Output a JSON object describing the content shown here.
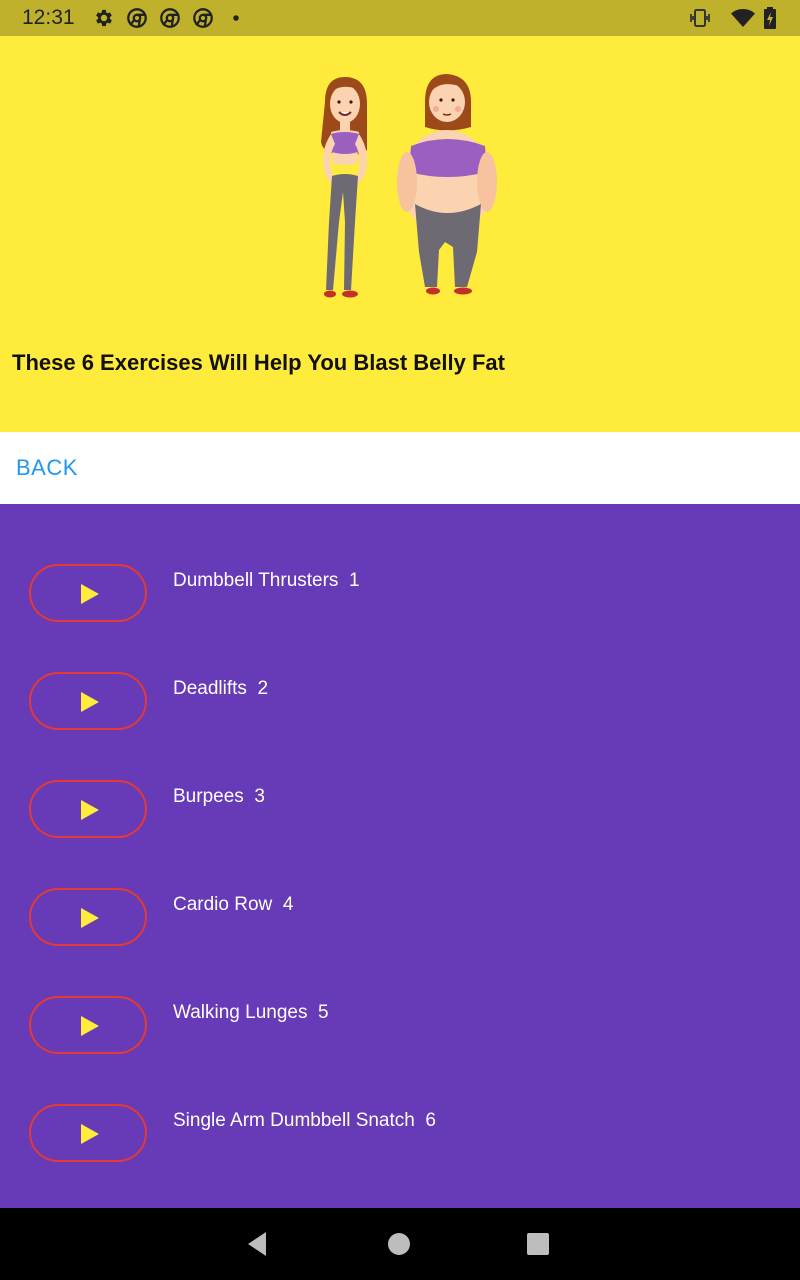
{
  "status_bar": {
    "time": "12:31",
    "icons_left": [
      "gear-icon",
      "chrome-icon",
      "chrome-icon",
      "chrome-icon",
      "dot-icon"
    ],
    "icons_right": [
      "vibrate-icon",
      "wifi-icon",
      "battery-icon"
    ]
  },
  "header": {
    "background": "#ffeb3b",
    "title": "These 6 Exercises Will Help You Blast Belly Fat"
  },
  "back_button": {
    "label": "BACK",
    "color": "#2196f3"
  },
  "exercises": [
    {
      "label": "Dumbbell Thrusters  1"
    },
    {
      "label": "Deadlifts  2"
    },
    {
      "label": "Burpees  3"
    },
    {
      "label": "Cardio Row  4"
    },
    {
      "label": "Walking Lunges  5"
    },
    {
      "label": "Single Arm Dumbbell Snatch  6"
    }
  ],
  "colors": {
    "list_background": "#673ab7",
    "play_border": "#e53935",
    "play_icon": "#ffeb3b",
    "status_bar": "#c0b12c"
  },
  "nav_bar": {
    "buttons": [
      "back-triangle-icon",
      "home-circle-icon",
      "recents-square-icon"
    ]
  }
}
